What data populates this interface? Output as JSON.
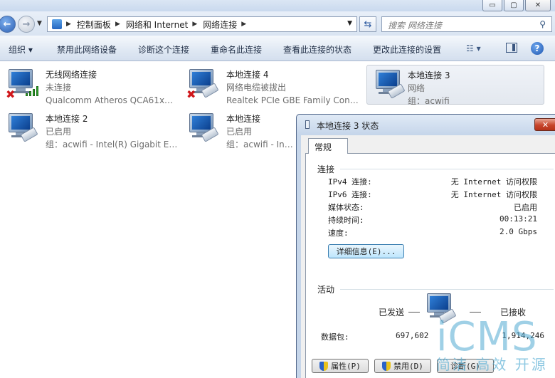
{
  "window": {
    "minimize_glyph": "▭",
    "maximize_glyph": "▢",
    "close_glyph": "✕"
  },
  "address": {
    "crumbs": [
      "控制面板",
      "网络和 Internet",
      "网络连接"
    ],
    "search_placeholder": "搜索 网络连接"
  },
  "toolbar": {
    "organize": "组织 ▾",
    "disable": "禁用此网络设备",
    "diagnose": "诊断这个连接",
    "rename": "重命名此连接",
    "status": "查看此连接的状态",
    "change_settings": "更改此连接的设置",
    "view_glyph": "☷ ▾",
    "help_glyph": "?"
  },
  "connections": [
    {
      "name": "无线网络连接",
      "line1": "未连接",
      "line2": "Qualcomm Atheros QCA61x4A...",
      "type": "wireless",
      "error": true
    },
    {
      "name": "本地连接 4",
      "line1": "网络电缆被拔出",
      "line2": "Realtek PCIe GBE Family Contr...",
      "type": "wired",
      "error": true
    },
    {
      "name": "本地连接 3",
      "line1": "网络",
      "line2": "组：acwifi",
      "type": "wired",
      "error": false,
      "selected": true
    },
    {
      "name": "本地连接 2",
      "line1": "已启用",
      "line2": "组：acwifi - Intel(R) Gigabit ET ...",
      "type": "wired",
      "error": false
    },
    {
      "name": "本地连接",
      "line1": "已启用",
      "line2": "组：acwifi - Intel(R) Gigabit ET ...",
      "type": "wired",
      "error": false
    }
  ],
  "dialog": {
    "title": "本地连接 3 状态",
    "close_glyph": "✕",
    "tab": "常规",
    "connection_group": "连接",
    "rows": [
      {
        "label": "IPv4 连接:",
        "value": "无 Internet 访问权限"
      },
      {
        "label": "IPv6 连接:",
        "value": "无 Internet 访问权限"
      },
      {
        "label": "媒体状态:",
        "value": "已启用"
      },
      {
        "label": "持续时间:",
        "value": "00:13:21"
      },
      {
        "label": "速度:",
        "value": "2.0 Gbps"
      }
    ],
    "details_button": "详细信息(E)...",
    "activity_group": "活动",
    "sent_label": "已发送",
    "received_label": "已接收",
    "packets_label": "数据包:",
    "packets_sent": "697,602",
    "packets_received": "1,914,246",
    "properties_button": "属性(P)",
    "disable_button": "禁用(D)",
    "diagnose_button": "诊断(G)"
  },
  "watermark": {
    "logo": "iCMS",
    "tagline": "简洁 高效 开源"
  }
}
